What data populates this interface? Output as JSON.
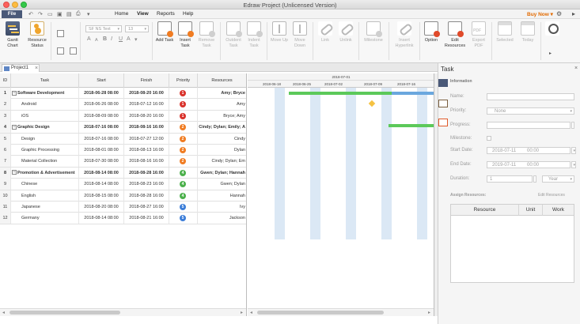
{
  "window": {
    "title": "Edraw Project (Unlicensed Version)"
  },
  "menubar": {
    "file": "File",
    "items": [
      "Home",
      "View",
      "Reports",
      "Help"
    ],
    "buy_now": "Buy Now"
  },
  "ribbon": {
    "gantt_chart": "Gantt Chart",
    "resource_status": "Resource Status",
    "font_name": "SF NS Text",
    "font_size": "13",
    "add_task": "Add Task",
    "insert_task": "Insert Task",
    "remove_task": "Remove Task",
    "outdent_task": "Outdent Task",
    "indent_task": "Indent Task",
    "move_up": "Move Up",
    "move_down": "Move Down",
    "link": "Link",
    "unlink": "Unlink",
    "milestone": "Milestone",
    "insert_hyperlink": "Insert Hyperlink",
    "option": "Option",
    "edit_resources": "Edit Resources",
    "export_pdf": "Export PDF",
    "selected": "Selected",
    "today": "Today"
  },
  "tabs": [
    {
      "label": "Project1"
    }
  ],
  "grid": {
    "columns": [
      "ID",
      "Task",
      "Start",
      "Finish",
      "Priority",
      "Resources"
    ],
    "rows": [
      {
        "id": "1",
        "task": "Software Development",
        "start": "2018-06-28 08:00",
        "finish": "2018-08-20 16:00",
        "priority": "1",
        "resources": "Amy; Bryce",
        "group": true
      },
      {
        "id": "2",
        "task": "Android",
        "start": "2018-06-26 08:00",
        "finish": "2018-07-12 16:00",
        "priority": "1",
        "resources": "Amy",
        "group": false
      },
      {
        "id": "3",
        "task": "iOS",
        "start": "2018-08-09 08:00",
        "finish": "2018-08-20 16:00",
        "priority": "1",
        "resources": "Bryce; Amy",
        "group": false
      },
      {
        "id": "4",
        "task": "Graphic Design",
        "start": "2018-07-16 08:00",
        "finish": "2018-08-16 16:00",
        "priority": "2",
        "resources": "Cindy; Dylan; Emily; A",
        "group": true
      },
      {
        "id": "5",
        "task": "Design",
        "start": "2018-07-16 08:00",
        "finish": "2018-07-27 12:00",
        "priority": "2",
        "resources": "Cindy",
        "group": false
      },
      {
        "id": "6",
        "task": "Graphic Processing",
        "start": "2018-08-01 08:00",
        "finish": "2018-08-13 16:00",
        "priority": "2",
        "resources": "Dylan",
        "group": false
      },
      {
        "id": "7",
        "task": "Material Collection",
        "start": "2018-07-30 08:00",
        "finish": "2018-08-16 16:00",
        "priority": "2",
        "resources": "Cindy; Dylan; Em",
        "group": false
      },
      {
        "id": "8",
        "task": "Promotion & Advertisement",
        "start": "2018-08-14 08:00",
        "finish": "2018-08-28 16:00",
        "priority": "4",
        "resources": "Gwen; Dylan; Hannah",
        "group": true
      },
      {
        "id": "9",
        "task": "Chinese",
        "start": "2018-08-14 08:00",
        "finish": "2018-08-23 16:00",
        "priority": "4",
        "resources": "Gwen; Dylan",
        "group": false
      },
      {
        "id": "10",
        "task": "English",
        "start": "2018-08-15 08:00",
        "finish": "2018-08-28 16:00",
        "priority": "4",
        "resources": "Hannah",
        "group": false
      },
      {
        "id": "11",
        "task": "Japanese",
        "start": "2018-08-20 08:00",
        "finish": "2018-08-27 16:00",
        "priority": "5",
        "resources": "Ivy",
        "group": false
      },
      {
        "id": "12",
        "task": "Germany",
        "start": "2018-08-14 08:00",
        "finish": "2018-08-21 16:00",
        "priority": "5",
        "resources": "Jackson",
        "group": false
      }
    ]
  },
  "chart": {
    "period_label": "2018-07-01",
    "day_labels": [
      "2018-06-18",
      "2018-06-25",
      "2018-07-02",
      "2018-07-09",
      "2018-07-16"
    ]
  },
  "colors": {
    "priority_1": "#d9322b",
    "priority_2": "#f07c22",
    "priority_4": "#4bb04b",
    "priority_5": "#3b7dd8",
    "bar_green": "#5cc95a",
    "bar_blue": "#6aa7de",
    "milestone": "#f5c242"
  },
  "panel": {
    "title": "Task",
    "section": "Information",
    "name_label": "Name:",
    "priority_label": "Priority:",
    "priority_value": "None",
    "progress_label": "Progress:",
    "milestone_label": "Milestone:",
    "start_label": "Start Date:",
    "start_date": "2018-07-11",
    "start_time": "00:00",
    "end_label": "End Date:",
    "end_date": "2019-07-11",
    "end_time": "00:00",
    "duration_label": "Duration:",
    "duration_value": "1",
    "duration_unit": "Year",
    "assign_label": "Assign Resources:",
    "edit_resources": "Edit Resources",
    "table_headers": [
      "Resource",
      "Unit",
      "Work"
    ]
  }
}
